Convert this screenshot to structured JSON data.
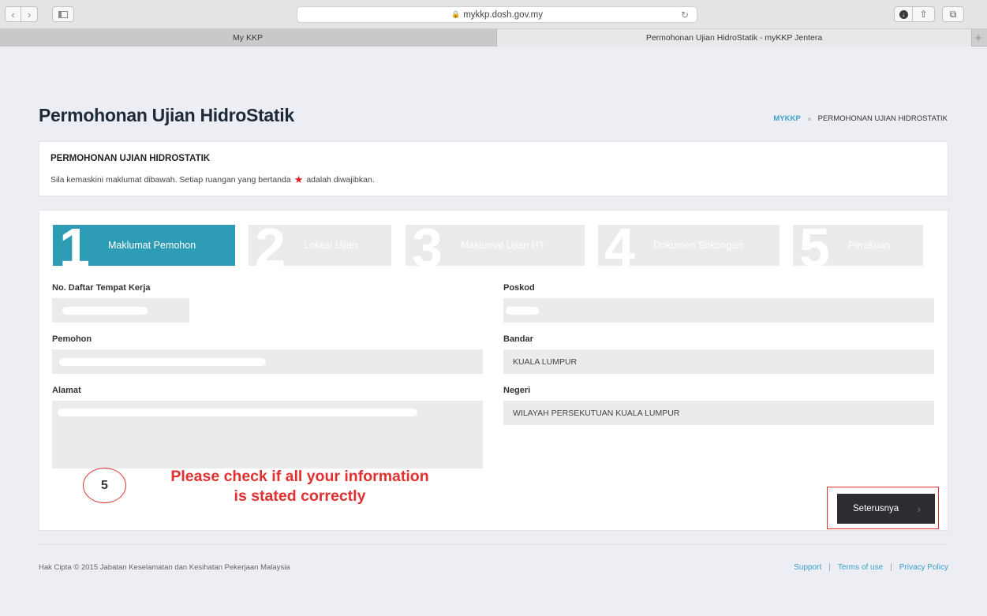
{
  "browser": {
    "url": "mykkp.dosh.gov.my",
    "tabs": [
      {
        "label": "My KKP",
        "active": false
      },
      {
        "label": "Permohonan Ujian HidroStatik - myKKP Jentera",
        "active": true
      }
    ],
    "new_tab_glyph": "+"
  },
  "page": {
    "title": "Permohonan Ujian HidroStatik",
    "breadcrumb": {
      "root": "MYKKP",
      "current": "PERMOHONAN UJIAN HIDROSTATIK"
    }
  },
  "info_panel": {
    "title": "PERMOHONAN UJIAN HIDROSTATIK",
    "text_before": "Sila kemaskini maklumat dibawah. Setiap ruangan yang bertanda",
    "text_after": "adalah diwajibkan."
  },
  "steps": [
    {
      "number": "1",
      "label": "Maklumat Pemohon",
      "active": true
    },
    {
      "number": "2",
      "label": "Lokasi Ujian",
      "active": false
    },
    {
      "number": "3",
      "label": "Maklumat Ujian HT",
      "active": false
    },
    {
      "number": "4",
      "label": "Dokumen Sokongan",
      "active": false
    },
    {
      "number": "5",
      "label": "Perakuan",
      "active": false
    }
  ],
  "fields": {
    "no_daftar": {
      "label": "No. Daftar Tempat Kerja",
      "value": ""
    },
    "pemohon": {
      "label": "Pemohon",
      "value": ""
    },
    "alamat": {
      "label": "Alamat",
      "value": ""
    },
    "poskod": {
      "label": "Poskod",
      "value": ""
    },
    "bandar": {
      "label": "Bandar",
      "value": "KUALA LUMPUR"
    },
    "negeri": {
      "label": "Negeri",
      "value": "WILAYAH PERSEKUTUAN KUALA LUMPUR"
    }
  },
  "annotation": {
    "number": "5",
    "line1": "Please check if all your information",
    "line2": "is stated correctly",
    "color": "#e03030"
  },
  "next_button": {
    "label": "Seterusnya"
  },
  "footer": {
    "copyright": "Hak Cipta © 2015 Jabatan Keselamatan dan Kesihatan Pekerjaan Malaysia",
    "links": [
      "Support",
      "Terms of use",
      "Privacy Policy"
    ]
  },
  "colors": {
    "accent": "#2f9cb5",
    "link": "#3aa0c8",
    "title": "#1e2a38",
    "button": "#2b2d31",
    "required_star": "#e02020"
  }
}
